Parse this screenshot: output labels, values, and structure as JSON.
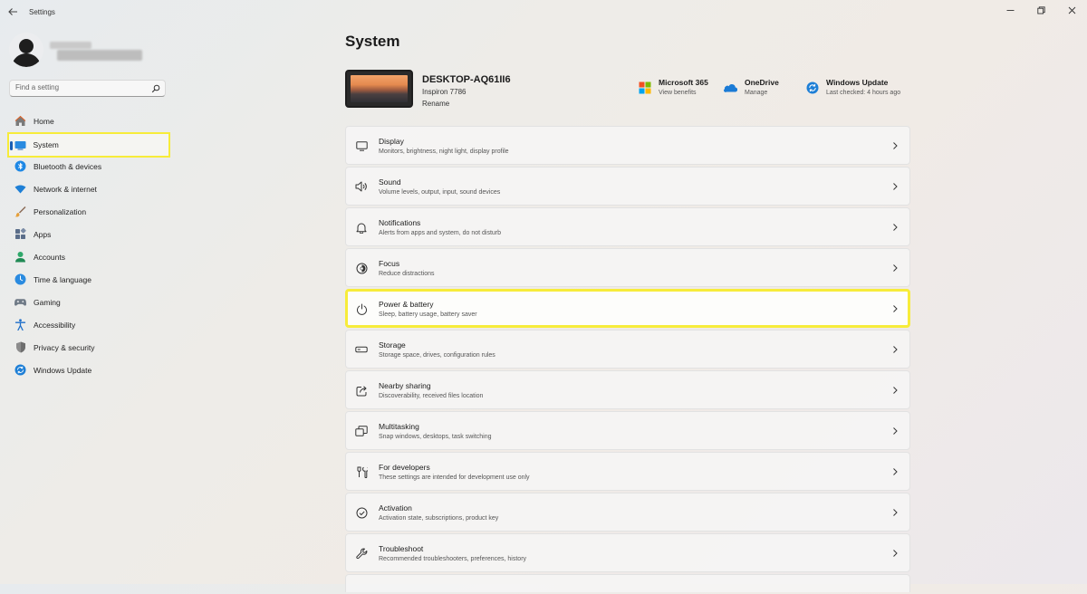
{
  "window": {
    "title": "Settings"
  },
  "user": {},
  "search": {
    "placeholder": "Find a setting"
  },
  "sidebar": {
    "items": [
      {
        "label": "Home",
        "icon": "home-icon"
      },
      {
        "label": "System",
        "icon": "system-icon",
        "selected": true
      },
      {
        "label": "Bluetooth & devices",
        "icon": "bluetooth-icon"
      },
      {
        "label": "Network & internet",
        "icon": "wifi-icon"
      },
      {
        "label": "Personalization",
        "icon": "brush-icon"
      },
      {
        "label": "Apps",
        "icon": "apps-icon"
      },
      {
        "label": "Accounts",
        "icon": "accounts-icon"
      },
      {
        "label": "Time & language",
        "icon": "globe-icon"
      },
      {
        "label": "Gaming",
        "icon": "gamepad-icon"
      },
      {
        "label": "Accessibility",
        "icon": "accessibility-icon"
      },
      {
        "label": "Privacy & security",
        "icon": "shield-icon"
      },
      {
        "label": "Windows Update",
        "icon": "update-icon"
      }
    ]
  },
  "main": {
    "title": "System",
    "device": {
      "name": "DESKTOP-AQ61II6",
      "model": "Inspiron 7786",
      "rename": "Rename"
    },
    "quick_links": [
      {
        "title": "Microsoft 365",
        "subtitle": "View benefits",
        "icon": "microsoft365-icon"
      },
      {
        "title": "OneDrive",
        "subtitle": "Manage",
        "icon": "onedrive-icon"
      },
      {
        "title": "Windows Update",
        "subtitle": "Last checked: 4 hours ago",
        "icon": "windows-update-icon"
      }
    ],
    "cards": [
      {
        "title": "Display",
        "subtitle": "Monitors, brightness, night light, display profile",
        "icon": "display-icon"
      },
      {
        "title": "Sound",
        "subtitle": "Volume levels, output, input, sound devices",
        "icon": "speaker-icon"
      },
      {
        "title": "Notifications",
        "subtitle": "Alerts from apps and system, do not disturb",
        "icon": "bell-icon"
      },
      {
        "title": "Focus",
        "subtitle": "Reduce distractions",
        "icon": "focus-icon"
      },
      {
        "title": "Power & battery",
        "subtitle": "Sleep, battery usage, battery saver",
        "icon": "power-icon",
        "highlighted": true
      },
      {
        "title": "Storage",
        "subtitle": "Storage space, drives, configuration rules",
        "icon": "storage-icon"
      },
      {
        "title": "Nearby sharing",
        "subtitle": "Discoverability, received files location",
        "icon": "share-icon"
      },
      {
        "title": "Multitasking",
        "subtitle": "Snap windows, desktops, task switching",
        "icon": "multitasking-icon"
      },
      {
        "title": "For developers",
        "subtitle": "These settings are intended for development use only",
        "icon": "developer-icon"
      },
      {
        "title": "Activation",
        "subtitle": "Activation state, subscriptions, product key",
        "icon": "check-circle-icon"
      },
      {
        "title": "Troubleshoot",
        "subtitle": "Recommended troubleshooters, preferences, history",
        "icon": "wrench-icon"
      }
    ]
  },
  "colors": {
    "accent": "#1a5fb4",
    "highlight": "#f7ec3a"
  }
}
